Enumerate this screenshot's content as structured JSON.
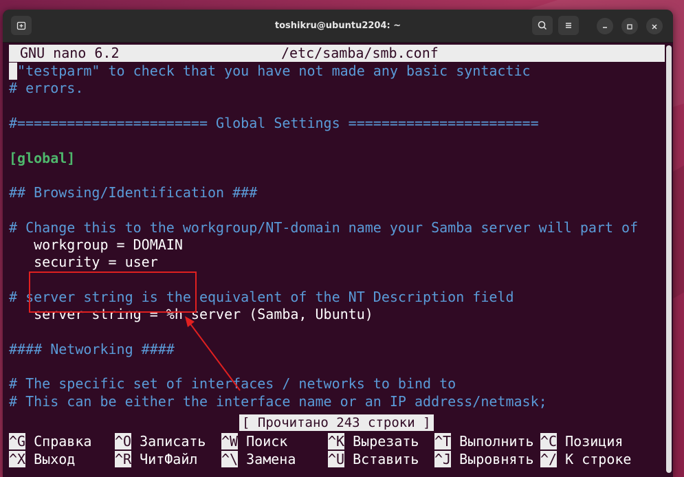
{
  "window": {
    "title": "toshikru@ubuntu2204: ~"
  },
  "icons": {
    "new_tab": "new-tab-icon",
    "search": "search-icon",
    "menu": "hamburger-menu-icon",
    "minimize": "minimize-icon",
    "maximize": "maximize-icon",
    "close": "close-icon"
  },
  "nano": {
    "version": "GNU nano 6.2",
    "filename": "/etc/samba/smb.conf",
    "status_message": "[ Прочитано 243 строки ]"
  },
  "file_lines": [
    {
      "text": " \"testparm\" to check that you have not made any basic syntactic",
      "kind": "comment"
    },
    {
      "text": "# errors.",
      "kind": "comment"
    },
    {
      "text": "",
      "kind": "plain"
    },
    {
      "text": "#======================= Global Settings =======================",
      "kind": "comment"
    },
    {
      "text": "",
      "kind": "plain"
    },
    {
      "text": "[global]",
      "kind": "section"
    },
    {
      "text": "",
      "kind": "plain"
    },
    {
      "text": "## Browsing/Identification ###",
      "kind": "comment"
    },
    {
      "text": "",
      "kind": "plain"
    },
    {
      "text": "# Change this to the workgroup/NT-domain name your Samba server will part of",
      "kind": "comment"
    },
    {
      "text": "   workgroup = DOMAIN",
      "kind": "plain"
    },
    {
      "text": "   security = user",
      "kind": "plain"
    },
    {
      "text": "",
      "kind": "plain"
    },
    {
      "text": "# server string is the equivalent of the NT Description field",
      "kind": "comment"
    },
    {
      "text": "   server string = %h server (Samba, Ubuntu)",
      "kind": "plain"
    },
    {
      "text": "",
      "kind": "plain"
    },
    {
      "text": "#### Networking ####",
      "kind": "comment"
    },
    {
      "text": "",
      "kind": "plain"
    },
    {
      "text": "# The specific set of interfaces / networks to bind to",
      "kind": "comment"
    },
    {
      "text": "# This can be either the interface name or an IP address/netmask;",
      "kind": "comment"
    }
  ],
  "shortcuts": [
    {
      "key": "^G",
      "label": "Справка"
    },
    {
      "key": "^O",
      "label": "Записать"
    },
    {
      "key": "^W",
      "label": "Поиск"
    },
    {
      "key": "^K",
      "label": "Вырезать"
    },
    {
      "key": "^T",
      "label": "Выполнить"
    },
    {
      "key": "^C",
      "label": "Позиция"
    },
    {
      "key": "^X",
      "label": "Выход"
    },
    {
      "key": "^R",
      "label": "ЧитФайл"
    },
    {
      "key": "^\\",
      "label": "Замена"
    },
    {
      "key": "^U",
      "label": "Вставить"
    },
    {
      "key": "^J",
      "label": "Выровнять"
    },
    {
      "key": "^/",
      "label": "К строке"
    }
  ],
  "colors": {
    "terminal_bg": "#300a24",
    "comment": "#5a9bd8",
    "section": "#4eb86c",
    "text": "#ffffff",
    "inverse_bg": "#ececec",
    "annotation": "#e02020"
  }
}
